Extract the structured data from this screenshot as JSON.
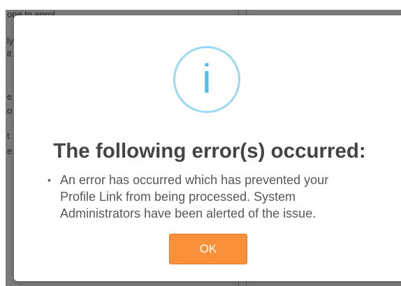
{
  "background": {
    "overlay_color": "#7b7b7b",
    "fragments": [
      "one to enrol",
      "ly",
      "it",
      "e",
      "o",
      "t",
      "e s"
    ]
  },
  "dialog": {
    "icon": "info-icon",
    "icon_glyph": "i",
    "icon_color": "#43c0ee",
    "title": "The following error(s) occurred:",
    "messages": [
      "An error has occurred which has prevented your Profile Link from being processed. System Administrators have been alerted of the issue."
    ],
    "ok_label": "OK",
    "ok_color": "#f8913a"
  }
}
